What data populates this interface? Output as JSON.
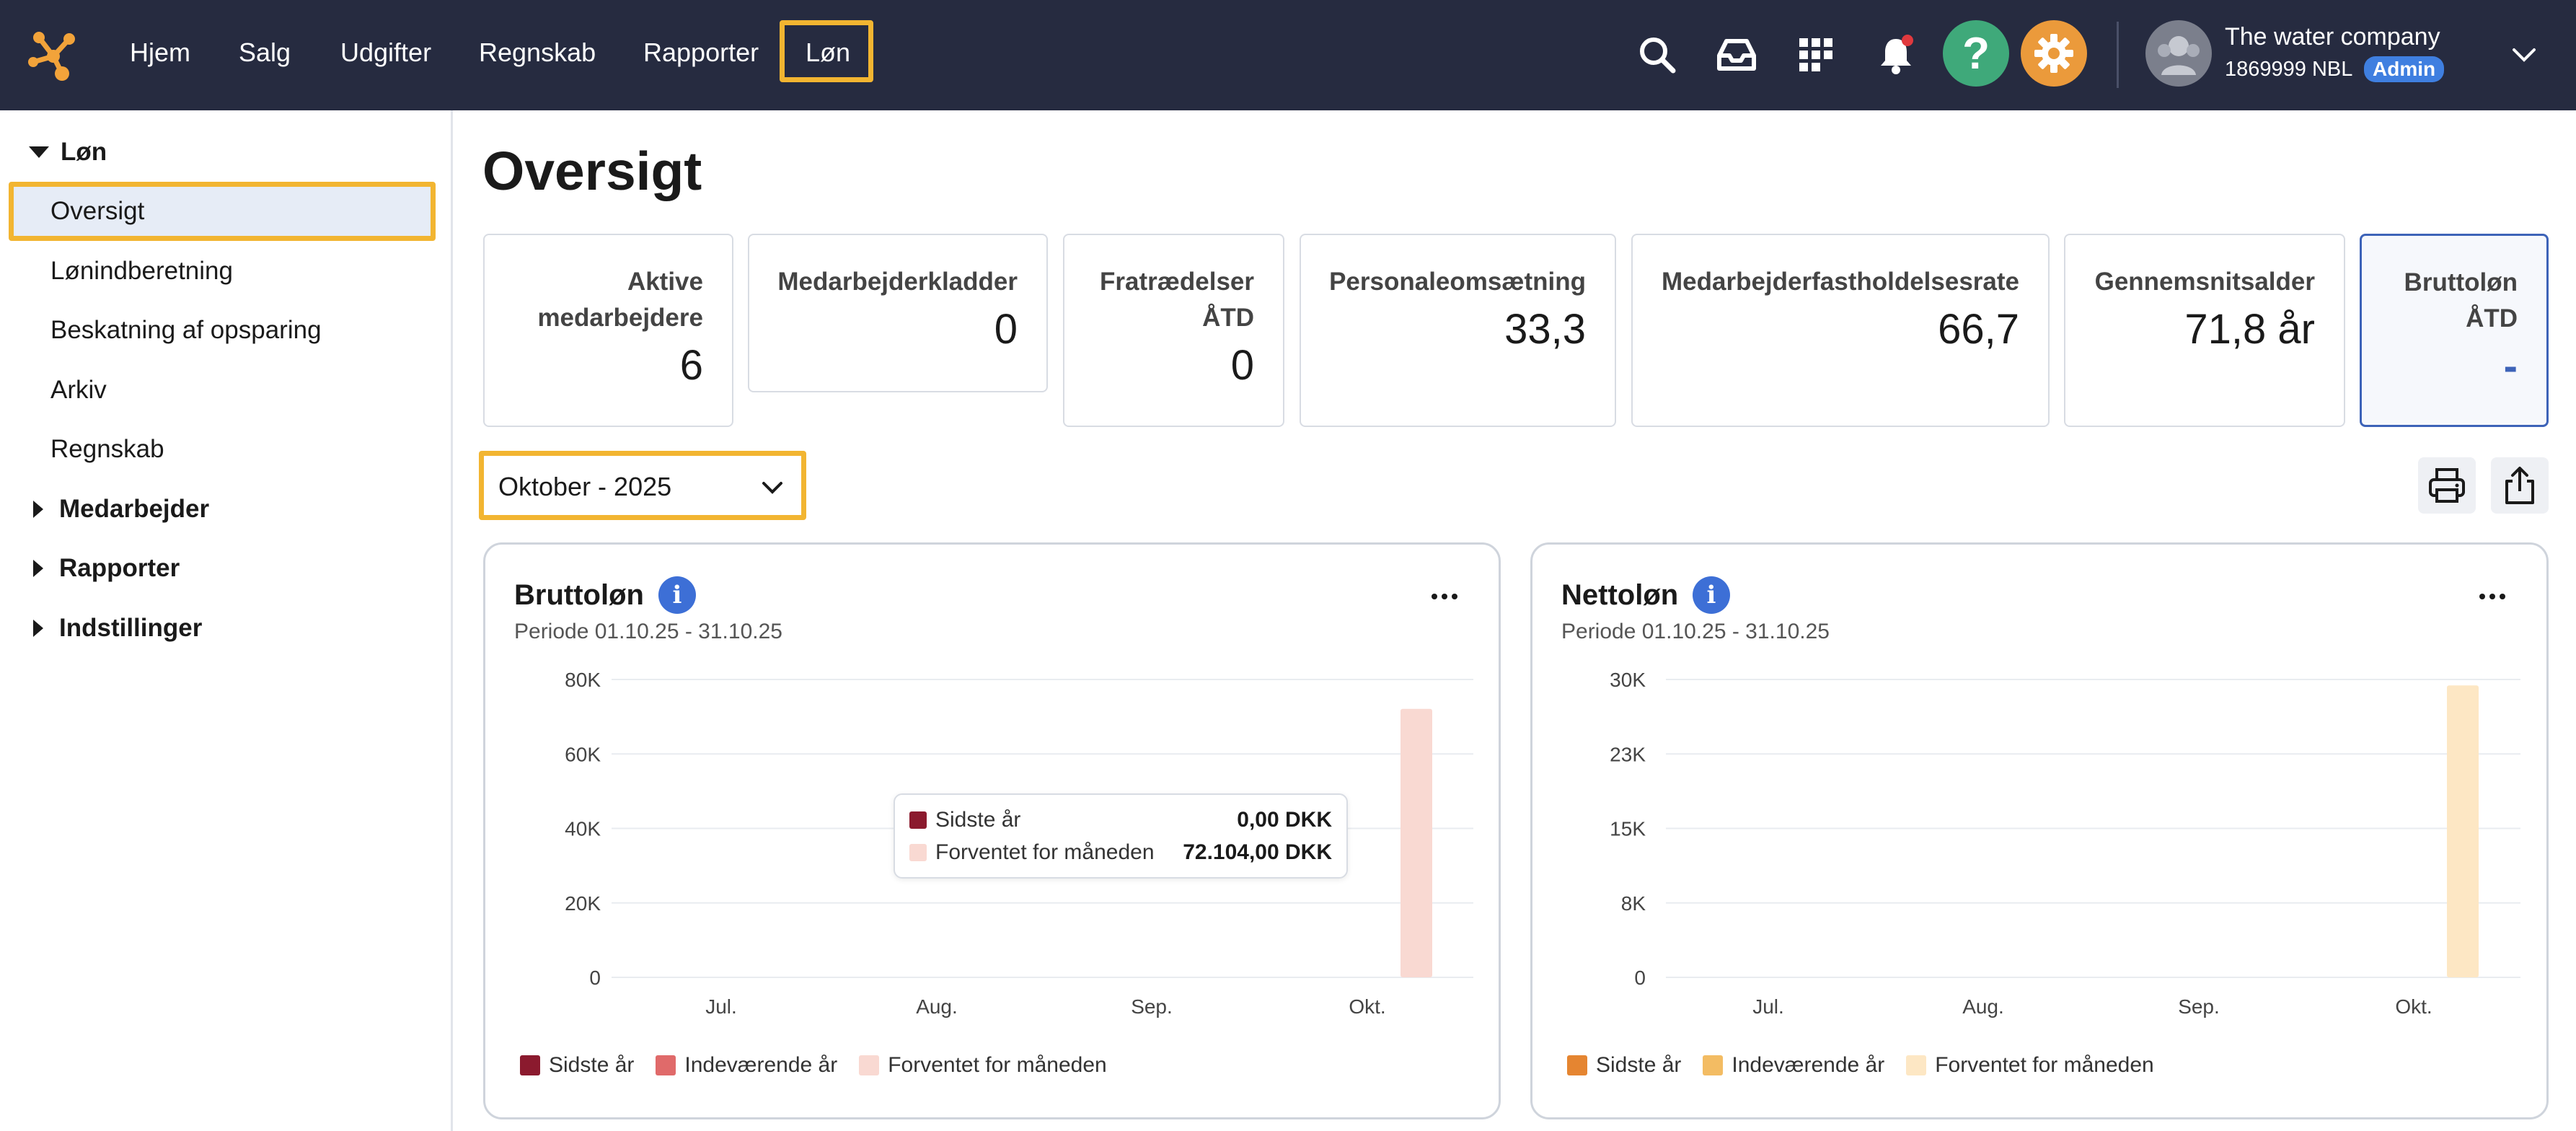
{
  "topbar": {
    "nav": [
      "Hjem",
      "Salg",
      "Udgifter",
      "Regnskab",
      "Rapporter",
      "Løn"
    ],
    "active_nav": "Løn",
    "icons": [
      "search-icon",
      "inbox-icon",
      "apps-grid-icon",
      "bell-icon",
      "help-icon",
      "settings-icon"
    ],
    "notification_dot_color": "#e0393e",
    "company_name": "The water company",
    "org_number": "1869999 NBL",
    "role_badge": "Admin"
  },
  "sidebar": {
    "section": "Løn",
    "items": [
      "Oversigt",
      "Lønindberetning",
      "Beskatning af opsparing",
      "Arkiv",
      "Regnskab"
    ],
    "selected": "Oversigt",
    "groups": [
      "Medarbejder",
      "Rapporter",
      "Indstillinger"
    ]
  },
  "main": {
    "title": "Oversigt",
    "kpis": [
      {
        "label": "Aktive medarbejdere",
        "value": "6"
      },
      {
        "label": "Medarbejderkladder",
        "value": "0"
      },
      {
        "label": "Fratrædelser ÅTD",
        "value": "0"
      },
      {
        "label": "Personaleomsætning",
        "value": "33,3"
      },
      {
        "label": "Medarbejderfastholdelsesrate",
        "value": "66,7"
      },
      {
        "label": "Gennemsnitsalder",
        "value": "71,8 år"
      },
      {
        "label": "Bruttoløn ÅTD",
        "value": "-"
      }
    ],
    "period_select": "Oktober - 2025",
    "tools": [
      "print-icon",
      "share-icon"
    ]
  },
  "chart_data": [
    {
      "type": "bar",
      "title": "Bruttoløn",
      "subtitle": "Periode 01.10.25 - 31.10.25",
      "categories": [
        "Jul.",
        "Aug.",
        "Sep.",
        "Okt."
      ],
      "y_ticks": [
        "0",
        "20K",
        "40K",
        "60K",
        "80K"
      ],
      "ylim": [
        0,
        80000
      ],
      "series": [
        {
          "name": "Sidste år",
          "color": "#8b1a2e",
          "values": [
            0,
            0,
            0,
            0
          ]
        },
        {
          "name": "Indeværende år",
          "color": "#e06a6a",
          "values": [
            0,
            0,
            0,
            0
          ]
        },
        {
          "name": "Forventet for måneden",
          "color": "#f9d9d2",
          "values": [
            0,
            0,
            0,
            72104
          ]
        }
      ],
      "tooltip": {
        "rows": [
          {
            "label": "Sidste år",
            "value": "0,00 DKK",
            "color": "#8b1a2e"
          },
          {
            "label": "Forventet for måneden",
            "value": "72.104,00 DKK",
            "color": "#f9d9d2"
          }
        ]
      },
      "legend_position": "bottom-left",
      "grid": true
    },
    {
      "type": "bar",
      "title": "Nettoløn",
      "subtitle": "Periode 01.10.25 - 31.10.25",
      "categories": [
        "Jul.",
        "Aug.",
        "Sep.",
        "Okt."
      ],
      "y_ticks": [
        "0",
        "8K",
        "15K",
        "23K",
        "30K"
      ],
      "ylim": [
        0,
        30000
      ],
      "series": [
        {
          "name": "Sidste år",
          "color": "#e58531",
          "values": [
            0,
            0,
            0,
            0
          ]
        },
        {
          "name": "Indeværende år",
          "color": "#f3bc63",
          "values": [
            0,
            0,
            0,
            0
          ]
        },
        {
          "name": "Forventet for måneden",
          "color": "#fde7c4",
          "values": [
            0,
            0,
            0,
            29400
          ]
        }
      ],
      "legend_position": "bottom-left",
      "grid": true
    }
  ]
}
